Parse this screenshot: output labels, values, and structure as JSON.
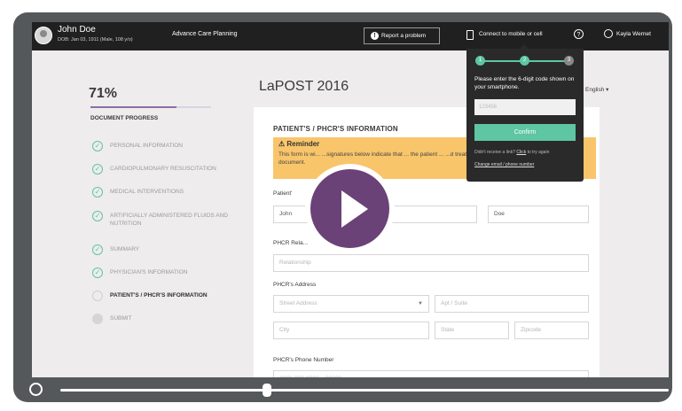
{
  "topbar": {
    "patient_name": "John Doe",
    "patient_dob": "DOB: Jan 03, 1911 (Male, 108 y/o)",
    "app_section": "Advance Care Planning",
    "report_label": "Report a problem",
    "mobile_label": "Connect to mobile or cell",
    "help_glyph": "?",
    "user_name": "Kayla Wernet"
  },
  "progress": {
    "percent_label": "71%",
    "percent_value": 71,
    "heading": "DOCUMENT PROGRESS",
    "steps": [
      {
        "label": "PERSONAL INFORMATION",
        "state": "done"
      },
      {
        "label": "CARDIOPULMONARY RESUSCITATION",
        "state": "done"
      },
      {
        "label": "MEDICAL INTERVENTIONS",
        "state": "done"
      },
      {
        "label": "ARTIFICIALLY ADMINISTERED FLUIDS AND NUTRITION",
        "state": "done"
      },
      {
        "label": "SUMMARY",
        "state": "done"
      },
      {
        "label": "PHYSICIAN'S INFORMATION",
        "state": "done"
      },
      {
        "label": "PATIENT'S / PHCR'S INFORMATION",
        "state": "current"
      },
      {
        "label": "SUBMIT",
        "state": "locked"
      }
    ]
  },
  "document": {
    "title": "LaPOST 2016",
    "language": "English ▾",
    "section_heading": "PATIENT'S / PHCR'S INFORMATION",
    "reminder_title": "⚠ Reminder",
    "reminder_body": "This form is wi... ...signatures below indicate that ... the patient ... ...d treatment plan and are t... ...h of the p... ... document.",
    "patient_label": "Patient'",
    "first_name_value": "John",
    "middle_suffix": "e",
    "last_name_value": "Doe",
    "phcr_rel_label": "PHCR Rela...",
    "relationship_placeholder": "Relationship",
    "address_label": "PHCR's Address",
    "street_placeholder": "Street Address",
    "apt_placeholder": "Apt / Suite",
    "city_placeholder": "City",
    "state_placeholder": "State",
    "zip_placeholder": "Zipcode",
    "phone_label": "PHCR's Phone Number",
    "phone_placeholder": "(000) 000-0000 ~ 00000"
  },
  "popup": {
    "steps": [
      "1",
      "2",
      "3"
    ],
    "instruction": "Please enter the 6-digit code shown on your smartphone.",
    "code_placeholder": "123456",
    "confirm_label": "Confirm",
    "resend_text": "Didn't receive a link?",
    "resend_link": "Click",
    "resend_suffix": "to try again",
    "change_link": "Change email / phone number"
  },
  "player": {
    "progress_fraction": 0.34
  },
  "colors": {
    "accent_green": "#5ec6a2",
    "accent_purple": "#6b4278",
    "reminder_yellow": "#f8c56b",
    "topbar": "#202020"
  }
}
